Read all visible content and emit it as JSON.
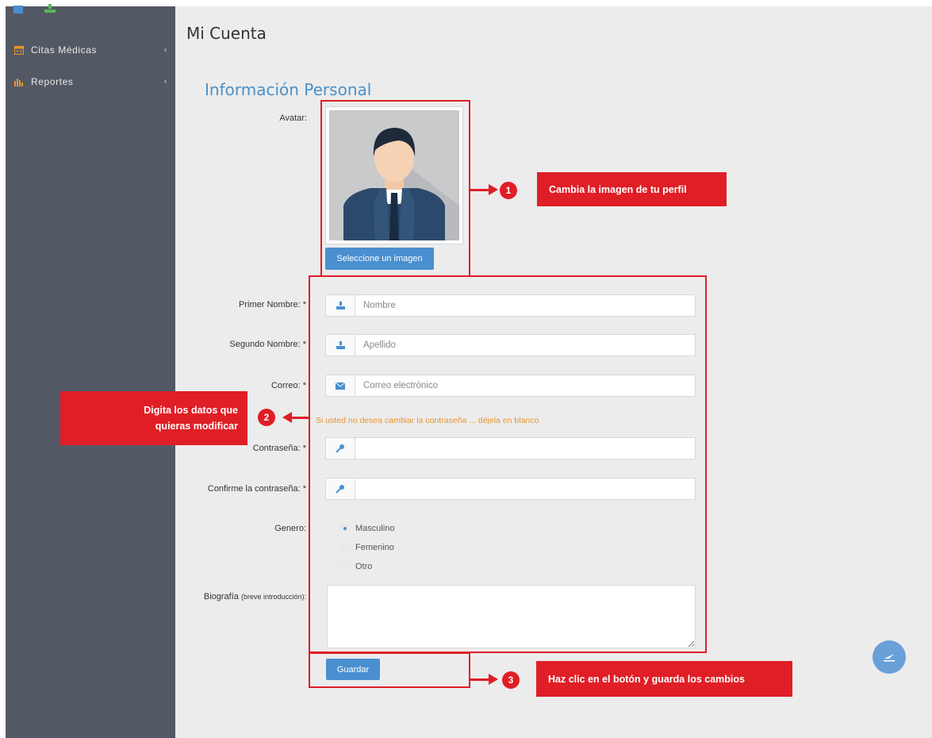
{
  "sidebar": {
    "items": [
      {
        "label": "Citas Médicas",
        "icon": "calendar-icon"
      },
      {
        "label": "Reportes",
        "icon": "bar-chart-icon"
      }
    ]
  },
  "page": {
    "title": "Mi Cuenta",
    "section_title": "Información Personal"
  },
  "form": {
    "avatar_label": "Avatar:",
    "select_image_label": "Seleccione un imagen",
    "first_name_label": "Primer Nombre:",
    "first_name_placeholder": "Nombre",
    "second_name_label": "Segundo Nombre:",
    "second_name_placeholder": "Apellido",
    "email_label": "Correo:",
    "email_placeholder": "Correo electrónico",
    "password_hint": "Si usted no desea cambiar la contraseña ... déjela en blanco",
    "password_label": "Contraseña:",
    "confirm_password_label": "Confirme la contraseña:",
    "required_mark": "*",
    "gender_label": "Genero:",
    "gender_options": [
      "Masculino",
      "Femenino",
      "Otro"
    ],
    "gender_selected": "Masculino",
    "bio_label": "Biografía",
    "bio_label_hint": "(breve introducción):",
    "save_label": "Guardar"
  },
  "annotations": [
    {
      "number": "1",
      "text": "Cambia la imagen de tu perfil"
    },
    {
      "number": "2",
      "text": "Digita los datos que quieras modificar"
    },
    {
      "number": "3",
      "text": "Haz clic en el botón y guarda los cambios"
    }
  ],
  "colors": {
    "sidebar": "#535964",
    "content_bg": "#ececec",
    "accent_blue": "#4a8fd0",
    "annotation_red": "#e01e26",
    "hint_orange": "#e8952e"
  }
}
